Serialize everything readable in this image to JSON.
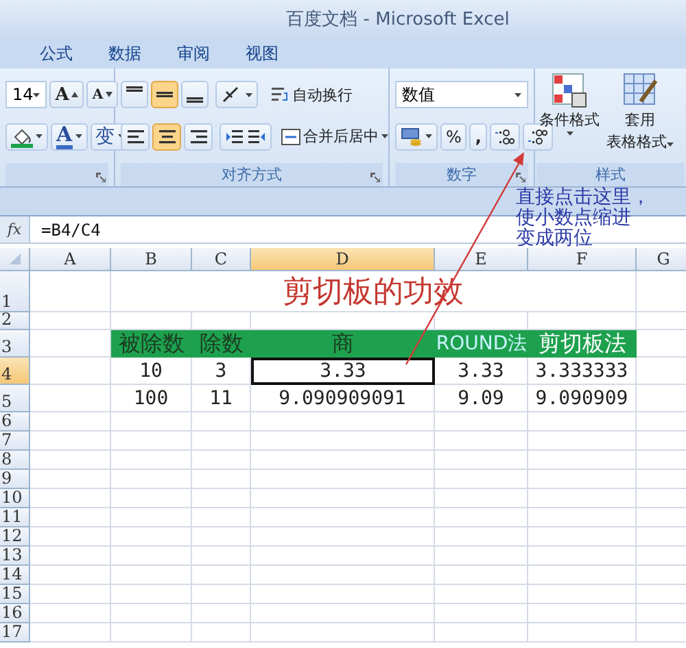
{
  "window": {
    "title": "百度文档 - Microsoft Excel"
  },
  "menu_tabs": [
    {
      "label": "公式",
      "selected": false
    },
    {
      "label": "数据",
      "selected": false
    },
    {
      "label": "审阅",
      "selected": false
    },
    {
      "label": "视图",
      "selected": false
    }
  ],
  "ribbon": {
    "font": {
      "size": "14",
      "grow": "A",
      "shrink": "A",
      "font_color": "A",
      "phonetic": "变"
    },
    "alignment": {
      "vertical": [
        {
          "selected": false
        },
        {
          "selected": true
        },
        {
          "selected": false
        }
      ],
      "horizontal": [
        {
          "selected": false
        },
        {
          "selected": true
        },
        {
          "selected": false
        }
      ],
      "wrap_text": "自动换行",
      "merge_center": "合并后居中",
      "label": "对齐方式"
    },
    "number": {
      "format": "数值",
      "percent": "%",
      "comma": ",",
      "label": "数字"
    },
    "styles": {
      "conditional": "条件格式",
      "table_format": [
        "套用",
        "表格格式"
      ],
      "label": "样式"
    }
  },
  "formula_bar": {
    "fx": "fx",
    "formula": "=B4/C4"
  },
  "sheet": {
    "columns": [
      {
        "label": "A",
        "selected": false
      },
      {
        "label": "B",
        "selected": false
      },
      {
        "label": "C",
        "selected": false
      },
      {
        "label": "D",
        "selected": true
      },
      {
        "label": "E",
        "selected": false
      },
      {
        "label": "F",
        "selected": false
      },
      {
        "label": "G",
        "selected": false
      }
    ],
    "rows": [
      {
        "label": "1",
        "selected": false,
        "kind": "title",
        "title": "剪切板的功效"
      },
      {
        "label": "2",
        "selected": false,
        "kind": "blank"
      },
      {
        "label": "3",
        "selected": false,
        "kind": "header",
        "cells": [
          {
            "text": "被除数",
            "color": "#1b3d22"
          },
          {
            "text": "除数",
            "color": "#1b3d22"
          },
          {
            "text": "商",
            "color": "#1b3d22"
          },
          {
            "text": "ROUND法",
            "color": "#c8f4ff"
          },
          {
            "text": "剪切板法",
            "color": "#ffffff"
          }
        ]
      },
      {
        "label": "4",
        "selected": true,
        "kind": "data",
        "cells": [
          {
            "text": "10",
            "selected": false
          },
          {
            "text": "3",
            "selected": false
          },
          {
            "text": "3.33",
            "selected": true
          },
          {
            "text": "3.33",
            "selected": false
          },
          {
            "text": "3.333333",
            "selected": false
          }
        ]
      },
      {
        "label": "5",
        "selected": false,
        "kind": "data",
        "cells": [
          {
            "text": "100",
            "selected": false
          },
          {
            "text": "11",
            "selected": false
          },
          {
            "text": "9.090909091",
            "selected": false
          },
          {
            "text": "9.09",
            "selected": false
          },
          {
            "text": "9.090909",
            "selected": false
          }
        ]
      },
      {
        "label": "6",
        "selected": false,
        "kind": "blank"
      },
      {
        "label": "7",
        "selected": false,
        "kind": "blank"
      },
      {
        "label": "8",
        "selected": false,
        "kind": "blank"
      },
      {
        "label": "9",
        "selected": false,
        "kind": "blank"
      },
      {
        "label": "10",
        "selected": false,
        "kind": "blank"
      },
      {
        "label": "11",
        "selected": false,
        "kind": "blank"
      },
      {
        "label": "12",
        "selected": false,
        "kind": "blank"
      },
      {
        "label": "13",
        "selected": false,
        "kind": "blank"
      },
      {
        "label": "14",
        "selected": false,
        "kind": "blank"
      },
      {
        "label": "15",
        "selected": false,
        "kind": "blank"
      },
      {
        "label": "16",
        "selected": false,
        "kind": "blank"
      },
      {
        "label": "17",
        "selected": false,
        "kind": "blank"
      }
    ]
  },
  "annotation": {
    "lines": [
      "直接点击这里，",
      "使小数点缩进",
      "变成两位"
    ]
  }
}
